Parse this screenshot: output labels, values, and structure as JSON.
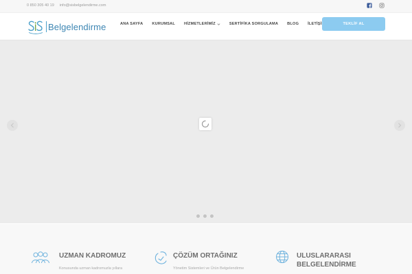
{
  "topbar": {
    "phone": "0 850 305 40 19",
    "email": "info@sisbelgelendirme.com",
    "socials": [
      {
        "icon": "facebook-icon"
      },
      {
        "icon": "instagram-icon"
      }
    ]
  },
  "header": {
    "logo_text": "Belgelendirme",
    "logo_mark_icon": "sis-logo-icon",
    "nav": [
      {
        "label": "ANA SAYFA"
      },
      {
        "label": "KURUMSAL"
      },
      {
        "label": "HİZMETLERİMİZ",
        "dropdown": true
      },
      {
        "label": "SERTİFİKA SORGULAMA"
      },
      {
        "label": "BLOG"
      },
      {
        "label": "İLETİŞİM"
      }
    ],
    "cta_label": "TEKLİF AL"
  },
  "slider": {
    "dots": 3,
    "prev_icon": "chevron-left-icon",
    "next_icon": "chevron-right-icon",
    "loader_icon": "spinner-icon"
  },
  "features": [
    {
      "title": "UZMAN KADROMUZ",
      "desc": "Konusunda uzman kadromuzla yıllara",
      "icon": "team-icon"
    },
    {
      "title": "ÇÖZÜM ORTAĞINIZ",
      "desc": "Yönetim Sistemleri ve Ürün Belgelendirme",
      "icon": "handshake-icon"
    },
    {
      "title": "ULUSLARARASI BELGELENDİRME",
      "desc": "",
      "icon": "globe-icon"
    }
  ],
  "colors": {
    "brand": "#3d86b3",
    "cta": "#8ccbf0",
    "slider_bg": "#ececec"
  }
}
